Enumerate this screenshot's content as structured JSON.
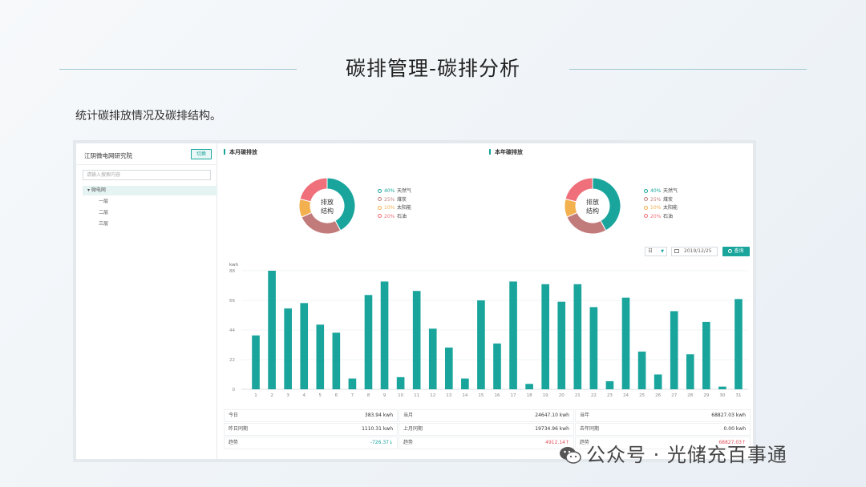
{
  "slide": {
    "title": "碳排管理-碳排分析",
    "subtitle": "统计碳排放情况及碳排结构。"
  },
  "left_panel": {
    "org_name": "江阴微电网研究院",
    "switch_label": "切换",
    "search_placeholder": "请输入搜索内容",
    "tree": {
      "root": "▾ 微电网",
      "children": [
        "一层",
        "二层",
        "三层"
      ]
    }
  },
  "month_section": {
    "title": "本月碳排放",
    "donut_label_line1": "排放",
    "donut_label_line2": "结构"
  },
  "year_section": {
    "title": "本年碳排放",
    "donut_label_line1": "排放",
    "donut_label_line2": "结构"
  },
  "structure_legend": [
    {
      "pct": "40%",
      "name": "天然气",
      "value": 40,
      "color": "#19a59c"
    },
    {
      "pct": "25%",
      "name": "煤炭",
      "value": 25,
      "color": "#c27b7b"
    },
    {
      "pct": "10%",
      "name": "太阳能",
      "value": 10,
      "color": "#f2b04e"
    },
    {
      "pct": "20%",
      "name": "石油",
      "value": 20,
      "color": "#ef6f7a"
    }
  ],
  "toolbar": {
    "select_value": "日",
    "date_value": "2019/12/25",
    "query_label": "查询"
  },
  "chart_data": {
    "type": "bar",
    "ylabel": "kwh",
    "ylim": [
      0,
      88
    ],
    "yticks": [
      0,
      22,
      44,
      66,
      88
    ],
    "grid": true,
    "color": "#19a59c",
    "categories": [
      "1",
      "2",
      "3",
      "4",
      "5",
      "6",
      "7",
      "8",
      "9",
      "10",
      "11",
      "12",
      "13",
      "14",
      "15",
      "16",
      "17",
      "18",
      "19",
      "20",
      "21",
      "22",
      "23",
      "24",
      "25",
      "26",
      "27",
      "28",
      "29",
      "30",
      "31"
    ],
    "values": [
      40,
      88,
      60,
      64,
      48,
      42,
      8,
      70,
      80,
      9,
      73,
      45,
      31,
      8,
      66,
      34,
      80,
      4,
      78,
      65,
      78,
      61,
      6,
      68,
      28,
      11,
      58,
      26,
      50,
      2,
      67
    ]
  },
  "stats": {
    "today_label": "今日",
    "today_value": "383.94 kwh",
    "yesterday_same_label": "昨日同期",
    "yesterday_same_value": "1110.31 kwh",
    "day_trend_label": "趋势",
    "day_trend_value": "-726.37↓",
    "month_label": "当月",
    "month_value": "24647.10 kwh",
    "last_month_label": "上月同期",
    "last_month_value": "19734.96 kwh",
    "month_trend_label": "趋势",
    "month_trend_value": "4912.14↑",
    "year_label": "当年",
    "year_value": "68827.03 kwh",
    "last_year_label": "去年同期",
    "last_year_value": "0.00 kwh",
    "year_trend_label": "趋势",
    "year_trend_value": "68827.03↑"
  },
  "watermark": {
    "text": "公众号 · 光储充百事通"
  }
}
